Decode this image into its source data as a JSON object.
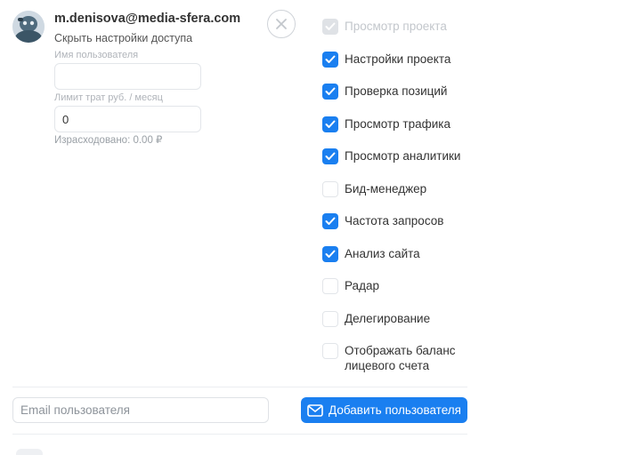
{
  "user": {
    "email": "m.denisova@media-sfera.com",
    "hide_settings_link": "Скрыть настройки доступа",
    "username_label": "Имя пользователя",
    "username_value": "",
    "limit_label": "Лимит трат руб. / месяц",
    "limit_value": "0",
    "spent_text": "Израсходовано: 0.00 ₽"
  },
  "permissions": [
    {
      "label": "Просмотр проекта",
      "checked": true,
      "disabled": true
    },
    {
      "label": "Настройки проекта",
      "checked": true,
      "disabled": false
    },
    {
      "label": "Проверка позиций",
      "checked": true,
      "disabled": false
    },
    {
      "label": "Просмотр трафика",
      "checked": true,
      "disabled": false
    },
    {
      "label": "Просмотр аналитики",
      "checked": true,
      "disabled": false
    },
    {
      "label": "Бид-менеджер",
      "checked": false,
      "disabled": false
    },
    {
      "label": "Частота запросов",
      "checked": true,
      "disabled": false
    },
    {
      "label": "Анализ сайта",
      "checked": true,
      "disabled": false
    },
    {
      "label": "Радар",
      "checked": false,
      "disabled": false
    },
    {
      "label": "Делегирование",
      "checked": false,
      "disabled": false
    },
    {
      "label": "Отображать баланс лицевого счета",
      "checked": false,
      "disabled": false
    }
  ],
  "add_user": {
    "email_placeholder": "Email пользователя",
    "button_label": "Добавить пользователя"
  },
  "colors": {
    "accent": "#1a7ff0"
  },
  "icons": {
    "close": "close-icon",
    "mail": "mail-icon",
    "check": "check-icon"
  }
}
